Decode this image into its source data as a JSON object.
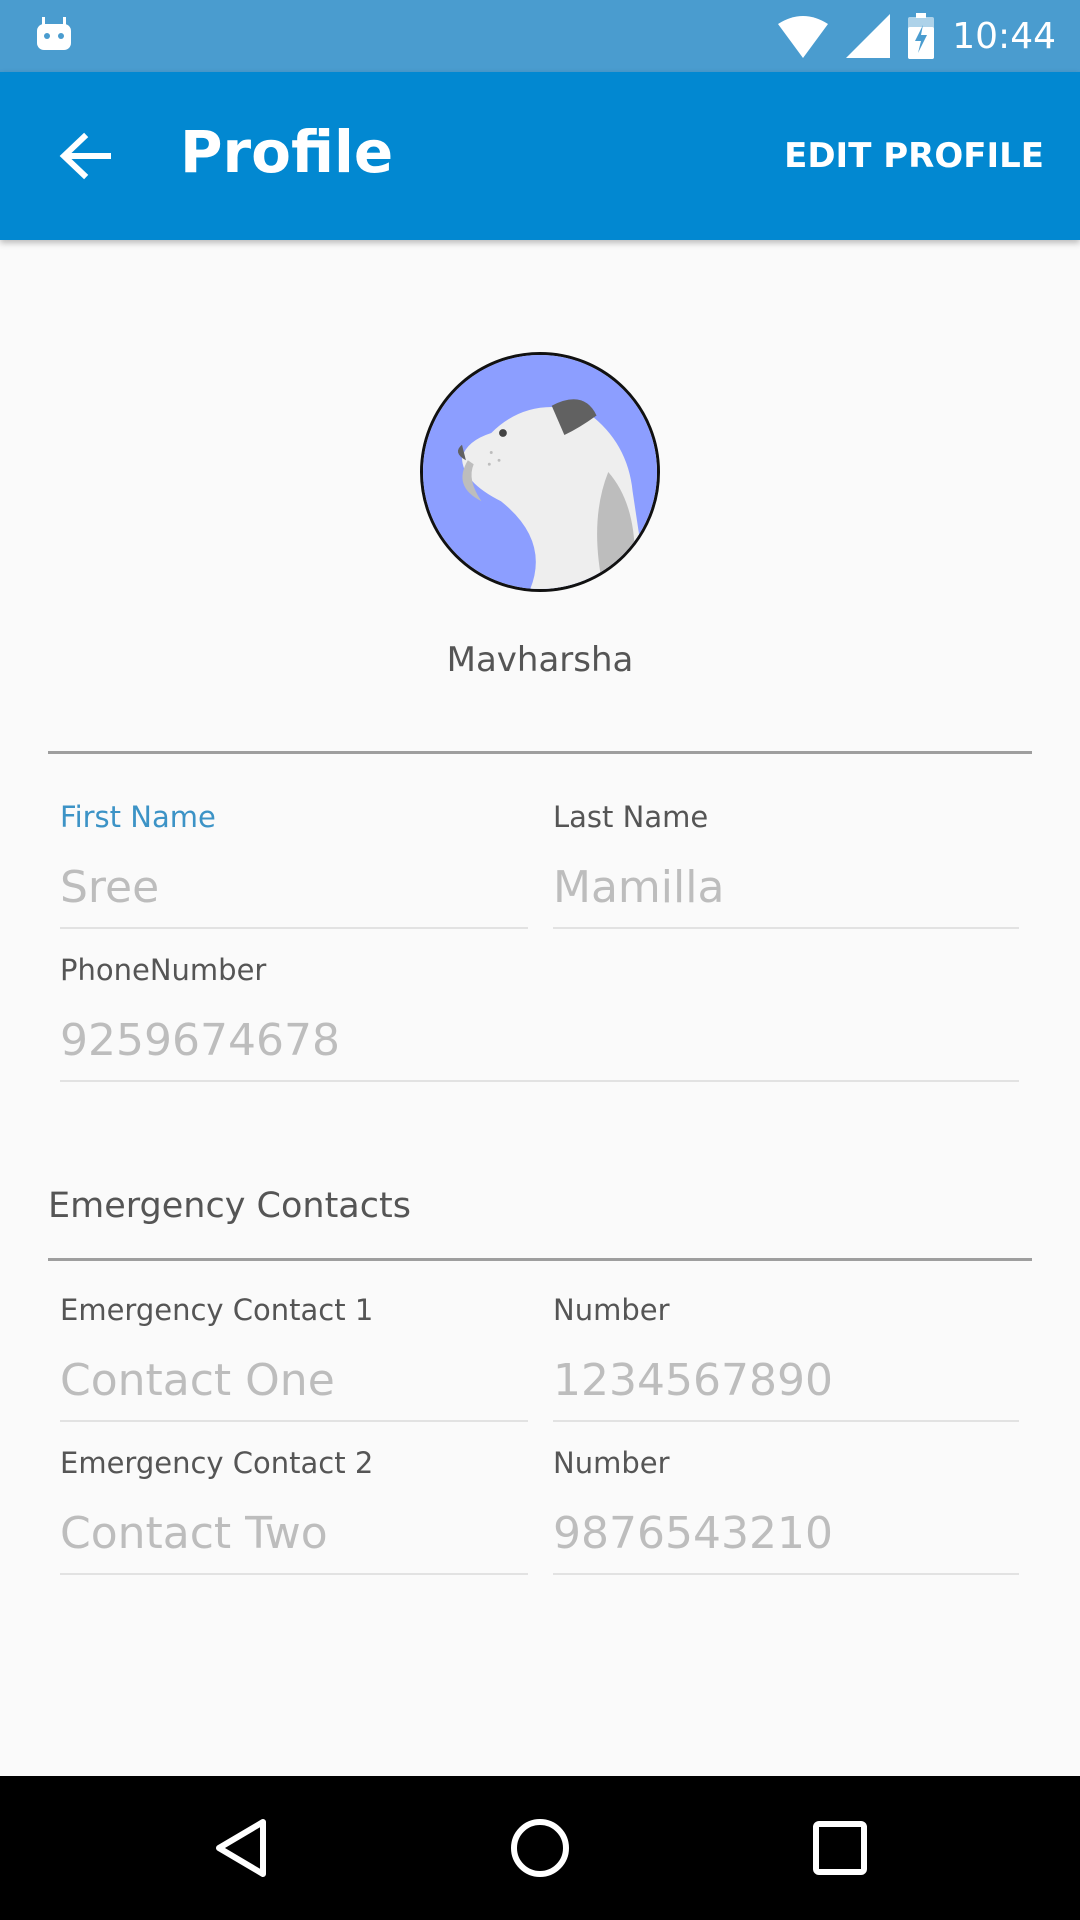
{
  "status_bar": {
    "time": "10:44",
    "icons": [
      "android-notification-icon",
      "wifi-icon",
      "signal-icon",
      "battery-charging-icon"
    ]
  },
  "app_bar": {
    "title": "Profile",
    "action_label": "EDIT PROFILE",
    "back_icon": "arrow-left-icon",
    "background": "#0288d1"
  },
  "profile": {
    "avatar_icon": "dog-avatar-icon",
    "display_name": "Mavharsha"
  },
  "fields": {
    "first_name": {
      "label": "First Name",
      "value": "Sree"
    },
    "last_name": {
      "label": "Last Name",
      "value": "Mamilla"
    },
    "phone": {
      "label": "PhoneNumber",
      "value": "9259674678"
    }
  },
  "emergency": {
    "section_title": "Emergency Contacts",
    "contacts": [
      {
        "name_label": "Emergency Contact 1",
        "name_value": "Contact One",
        "number_label": "Number",
        "number_value": "1234567890"
      },
      {
        "name_label": "Emergency Contact 2",
        "name_value": "Contact Two",
        "number_label": "Number",
        "number_value": "9876543210"
      }
    ]
  },
  "nav_bar": {
    "icons": [
      "back-triangle-icon",
      "home-circle-icon",
      "recents-square-icon"
    ]
  },
  "colors": {
    "accent": "#3c93c6",
    "status_bar": "#4a9ccf",
    "hint_text": "#bdbdbd",
    "label_text": "#555555"
  }
}
